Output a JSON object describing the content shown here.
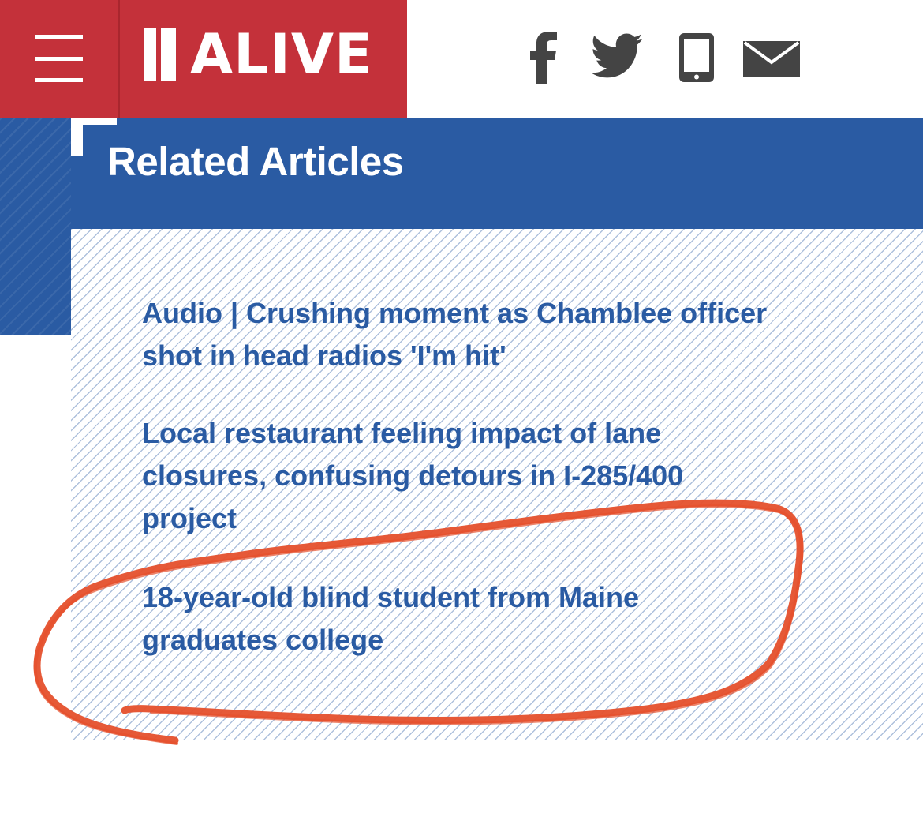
{
  "header": {
    "brand_name": "ALIVE",
    "brand_color": "#c4313a",
    "menu_icon": "hamburger-menu-icon",
    "share_icons": [
      "facebook-icon",
      "twitter-icon",
      "phone-icon",
      "email-icon"
    ]
  },
  "related": {
    "title": "Related Articles",
    "band_color": "#2a5ba3",
    "articles": [
      {
        "title": "Audio | Crushing moment as Chamblee officer shot in head radios 'I'm hit'"
      },
      {
        "title": "Local restaurant feeling impact of lane closures, confusing detours in I-285/400 project"
      },
      {
        "title": "18-year-old blind student from Maine graduates college"
      }
    ]
  },
  "annotation": {
    "color": "#e5502c",
    "circled_article_index": 2
  }
}
